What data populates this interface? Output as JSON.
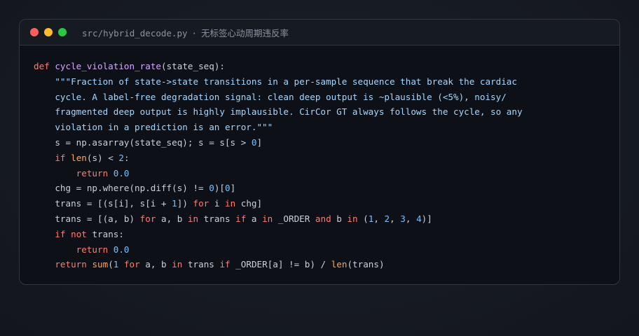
{
  "window": {
    "file_path": "src/hybrid_decode.py",
    "separator": "·",
    "subtitle": "无标签心动周期违反率"
  },
  "code": {
    "lines": [
      [
        {
          "t": "def",
          "c": "k"
        },
        {
          "t": " ",
          "c": "p"
        },
        {
          "t": "cycle_violation_rate",
          "c": "f"
        },
        {
          "t": "(state_seq):",
          "c": "p"
        }
      ],
      [
        {
          "t": "    \"\"\"Fraction of state->state transitions in a per-sample sequence that break the cardiac",
          "c": "s"
        }
      ],
      [
        {
          "t": "    cycle. A label-free degradation signal: clean deep output is ~plausible (<5%), noisy/",
          "c": "s"
        }
      ],
      [
        {
          "t": "    fragmented deep output is highly implausible. CirCor GT always follows the cycle, so any",
          "c": "s"
        }
      ],
      [
        {
          "t": "    violation in a prediction is an error.\"\"\"",
          "c": "s"
        }
      ],
      [
        {
          "t": "    s = np.asarray(state_seq); s = s[s > ",
          "c": "p"
        },
        {
          "t": "0",
          "c": "n"
        },
        {
          "t": "]",
          "c": "p"
        }
      ],
      [
        {
          "t": "    ",
          "c": "p"
        },
        {
          "t": "if",
          "c": "k"
        },
        {
          "t": " ",
          "c": "p"
        },
        {
          "t": "len",
          "c": "b"
        },
        {
          "t": "(s) < ",
          "c": "p"
        },
        {
          "t": "2",
          "c": "n"
        },
        {
          "t": ":",
          "c": "p"
        }
      ],
      [
        {
          "t": "        ",
          "c": "p"
        },
        {
          "t": "return",
          "c": "k"
        },
        {
          "t": " ",
          "c": "p"
        },
        {
          "t": "0.0",
          "c": "n"
        }
      ],
      [
        {
          "t": "    chg = np.where(np.diff(s) != ",
          "c": "p"
        },
        {
          "t": "0",
          "c": "n"
        },
        {
          "t": ")[",
          "c": "p"
        },
        {
          "t": "0",
          "c": "n"
        },
        {
          "t": "]",
          "c": "p"
        }
      ],
      [
        {
          "t": "    trans = [(s[i], s[i + ",
          "c": "p"
        },
        {
          "t": "1",
          "c": "n"
        },
        {
          "t": "]) ",
          "c": "p"
        },
        {
          "t": "for",
          "c": "k"
        },
        {
          "t": " i ",
          "c": "p"
        },
        {
          "t": "in",
          "c": "k"
        },
        {
          "t": " chg]",
          "c": "p"
        }
      ],
      [
        {
          "t": "    trans = [(a, b) ",
          "c": "p"
        },
        {
          "t": "for",
          "c": "k"
        },
        {
          "t": " a, b ",
          "c": "p"
        },
        {
          "t": "in",
          "c": "k"
        },
        {
          "t": " trans ",
          "c": "p"
        },
        {
          "t": "if",
          "c": "k"
        },
        {
          "t": " a ",
          "c": "p"
        },
        {
          "t": "in",
          "c": "k"
        },
        {
          "t": " _ORDER ",
          "c": "p"
        },
        {
          "t": "and",
          "c": "k"
        },
        {
          "t": " b ",
          "c": "p"
        },
        {
          "t": "in",
          "c": "k"
        },
        {
          "t": " (",
          "c": "p"
        },
        {
          "t": "1",
          "c": "n"
        },
        {
          "t": ", ",
          "c": "p"
        },
        {
          "t": "2",
          "c": "n"
        },
        {
          "t": ", ",
          "c": "p"
        },
        {
          "t": "3",
          "c": "n"
        },
        {
          "t": ", ",
          "c": "p"
        },
        {
          "t": "4",
          "c": "n"
        },
        {
          "t": ")]",
          "c": "p"
        }
      ],
      [
        {
          "t": "    ",
          "c": "p"
        },
        {
          "t": "if",
          "c": "k"
        },
        {
          "t": " ",
          "c": "p"
        },
        {
          "t": "not",
          "c": "k"
        },
        {
          "t": " trans:",
          "c": "p"
        }
      ],
      [
        {
          "t": "        ",
          "c": "p"
        },
        {
          "t": "return",
          "c": "k"
        },
        {
          "t": " ",
          "c": "p"
        },
        {
          "t": "0.0",
          "c": "n"
        }
      ],
      [
        {
          "t": "    ",
          "c": "p"
        },
        {
          "t": "return",
          "c": "k"
        },
        {
          "t": " ",
          "c": "p"
        },
        {
          "t": "sum",
          "c": "b"
        },
        {
          "t": "(",
          "c": "p"
        },
        {
          "t": "1",
          "c": "n"
        },
        {
          "t": " ",
          "c": "p"
        },
        {
          "t": "for",
          "c": "k"
        },
        {
          "t": " a, b ",
          "c": "p"
        },
        {
          "t": "in",
          "c": "k"
        },
        {
          "t": " trans ",
          "c": "p"
        },
        {
          "t": "if",
          "c": "k"
        },
        {
          "t": " _ORDER[a] != b) / ",
          "c": "p"
        },
        {
          "t": "len",
          "c": "b"
        },
        {
          "t": "(trans)",
          "c": "p"
        }
      ]
    ]
  }
}
